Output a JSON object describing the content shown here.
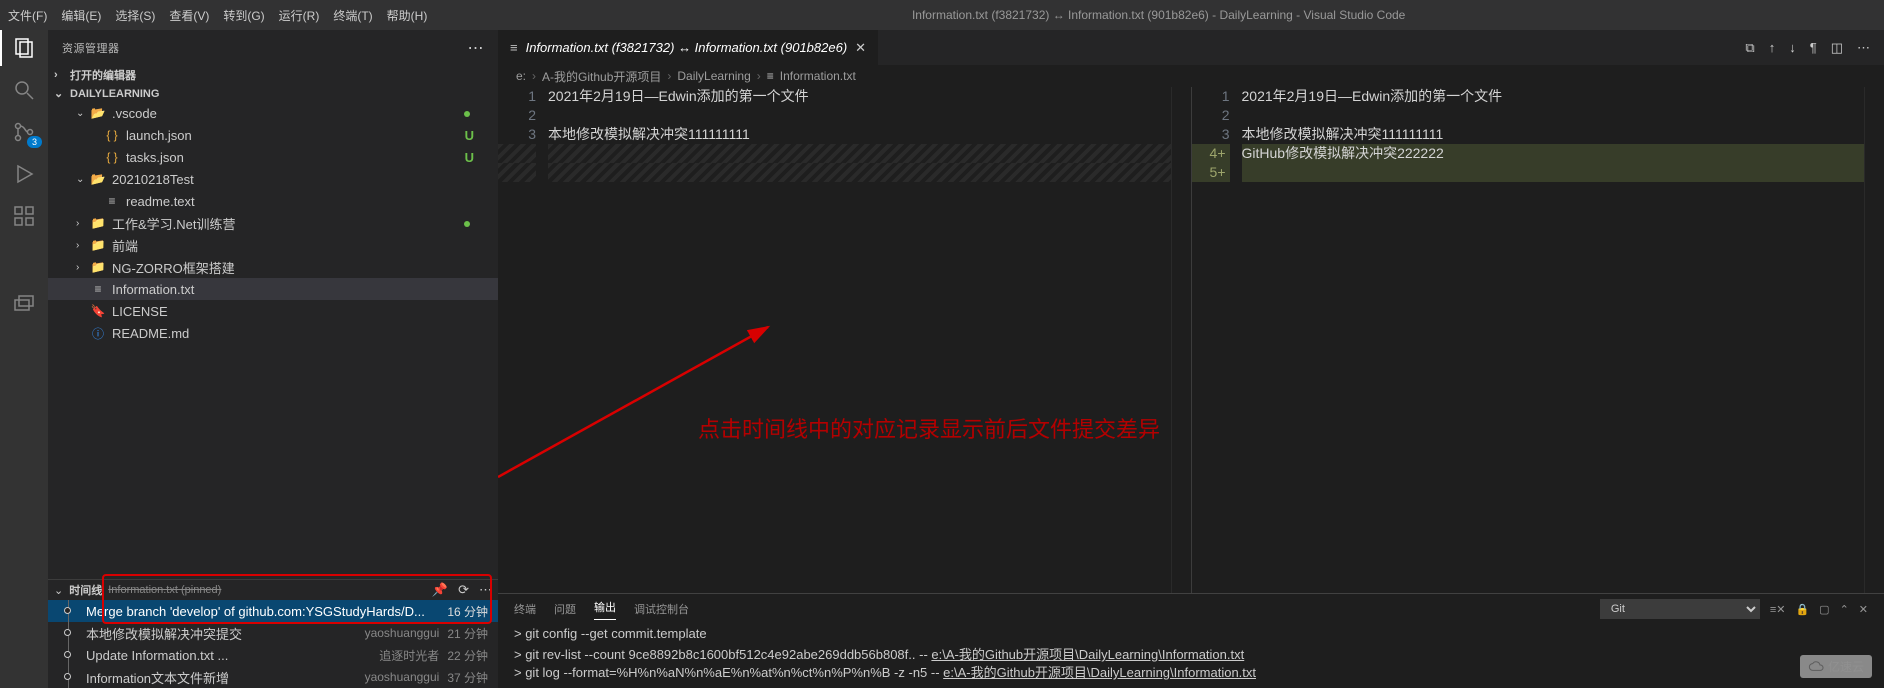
{
  "menubar": {
    "items": [
      "文件(F)",
      "编辑(E)",
      "选择(S)",
      "查看(V)",
      "转到(G)",
      "运行(R)",
      "终端(T)",
      "帮助(H)"
    ],
    "title_center": "Information.txt (f3821732) ↔ Information.txt (901b82e6) - DailyLearning - Visual Studio Code"
  },
  "activitybar": {
    "scm_badge": "3"
  },
  "sidebar": {
    "title": "资源管理器",
    "open_editors": "打开的编辑器",
    "repo": "DAILYLEARNING",
    "tree": [
      {
        "type": "folder-open",
        "label": ".vscode",
        "indent": 1,
        "dot": true
      },
      {
        "type": "json",
        "label": "launch.json",
        "indent": 2,
        "u": true
      },
      {
        "type": "json",
        "label": "tasks.json",
        "indent": 2,
        "u": true
      },
      {
        "type": "folder-open",
        "label": "20210218Test",
        "indent": 1
      },
      {
        "type": "lines",
        "label": "readme.text",
        "indent": 2
      },
      {
        "type": "folder",
        "label": "工作&学习.Net训练营",
        "indent": 1,
        "dot": true
      },
      {
        "type": "folder",
        "label": "前端",
        "indent": 1
      },
      {
        "type": "folder",
        "label": "NG-ZORRO框架搭建",
        "indent": 1
      },
      {
        "type": "lines",
        "label": "Information.txt",
        "indent": 1,
        "selected": true
      },
      {
        "type": "cert",
        "label": "LICENSE",
        "indent": 1
      },
      {
        "type": "info",
        "label": "README.md",
        "indent": 1
      }
    ]
  },
  "timeline": {
    "title": "时间线",
    "pinned_file": "Information.txt (pinned)",
    "rows": [
      {
        "label": "Merge branch 'develop' of github.com:YSGStudyHards/D...",
        "author": "",
        "time": "16 分钟",
        "active": true
      },
      {
        "label": "本地修改模拟解决冲突提交",
        "author": "yaoshuanggui",
        "time": "21 分钟"
      },
      {
        "label": "Update Information.txt ...",
        "author": "追逐时光者",
        "time": "22 分钟"
      },
      {
        "label": "Information文本文件新增",
        "author": "yaoshuanggui",
        "time": "37 分钟"
      }
    ]
  },
  "editor": {
    "tab_title": "Information.txt (f3821732) ↔ Information.txt (901b82e6)",
    "breadcrumb": [
      "e:",
      "A-我的Github开源项目",
      "DailyLearning",
      "Information.txt"
    ],
    "left_lines": {
      "1": "2021年2月19日—Edwin添加的第一个文件",
      "2": "",
      "3": "本地修改模拟解决冲突111111111"
    },
    "right_lines": {
      "1": "2021年2月19日—Edwin添加的第一个文件",
      "2": "",
      "3": "本地修改模拟解决冲突111111111",
      "4": "GitHub修改模拟解决冲突222222",
      "5": ""
    }
  },
  "annotation": {
    "text": "点击时间线中的对应记录显示前后文件提交差异"
  },
  "panel": {
    "tabs": [
      "终端",
      "问题",
      "输出",
      "调试控制台"
    ],
    "active_tab": "输出",
    "selector": "Git",
    "lines": [
      "> git config --get commit.template",
      "> git rev-list --count 9ce8892b8c1600bf512c4e92abe269ddb56b808f.. -- e:\\A-我的Github开源项目\\DailyLearning\\Information.txt",
      "> git log --format=%H%n%aN%n%aE%n%at%n%ct%n%P%n%B -z -n5 -- e:\\A-我的Github开源项目\\DailyLearning\\Information.txt"
    ]
  },
  "watermark": "亿速云"
}
